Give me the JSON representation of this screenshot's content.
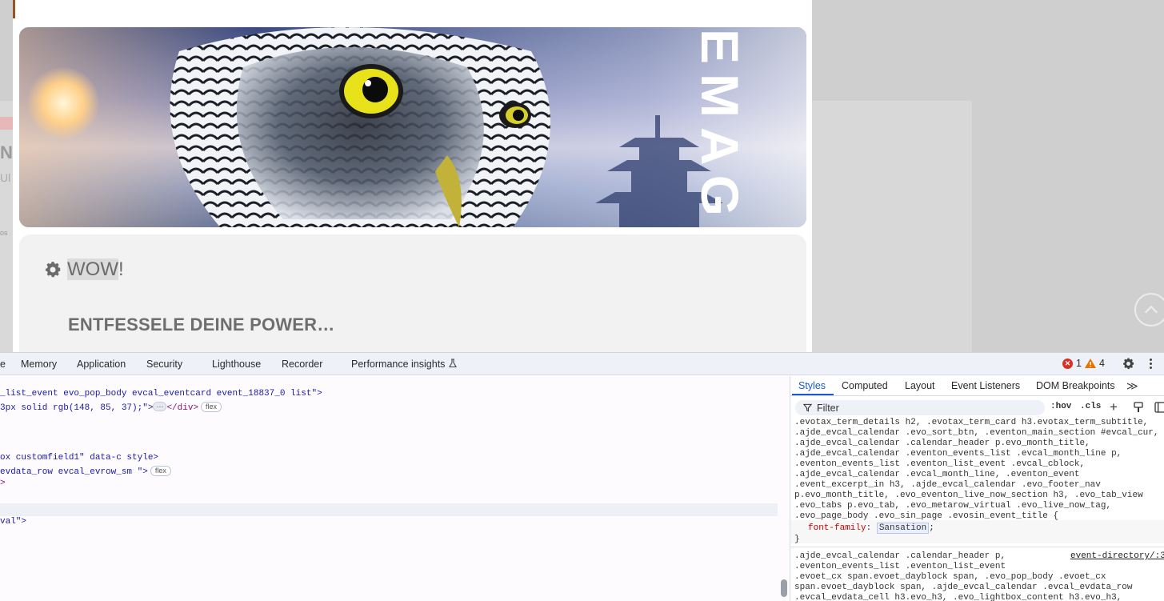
{
  "page": {
    "popup": {
      "banner_text": "EMAG",
      "heading_prefix": "WOW",
      "heading_suffix": "!",
      "subtitle": "ENTFESSELE DEINE POWER…",
      "accent_color": "#945525"
    }
  },
  "devtools": {
    "tabs": [
      {
        "label": "e"
      },
      {
        "label": "Memory"
      },
      {
        "label": "Application"
      },
      {
        "label": "Security"
      },
      {
        "label": "Lighthouse"
      },
      {
        "label": "Recorder"
      },
      {
        "label": "Performance insights"
      }
    ],
    "status": {
      "errors": "1",
      "warnings": "4"
    },
    "elements": {
      "lines": [
        {
          "pre": "_list_event evo_pop_body evcal_eventcard event_18837_0 list\">",
          "badge": ""
        },
        {
          "pre": "3px solid rgb(148, 85, 37);\">",
          "ellipsis": "⋯",
          "post": "</div>",
          "badge": "flex"
        },
        {
          "pre": "ox customfield1\" data-c style>",
          "badge": ""
        },
        {
          "pre": "evdata_row evcal_evrow_sm \">",
          "badge": "flex"
        },
        {
          "pre": ">",
          "badge": ""
        },
        {
          "pre": "val\">",
          "badge": ""
        }
      ]
    },
    "styles": {
      "tabs": [
        {
          "label": "Styles"
        },
        {
          "label": "Computed"
        },
        {
          "label": "Layout"
        },
        {
          "label": "Event Listeners"
        },
        {
          "label": "DOM Breakpoints"
        }
      ],
      "more_label": "≫",
      "filter_placeholder": "Filter",
      "hov_label": ":hov",
      "cls_label": ".cls",
      "add_label": "+",
      "rule1_selectors": [
        ".evotax_term_details h2, .evotax_term_card h3.evotax_term_subtitle,",
        ".ajde_evcal_calendar .evo_sort_btn, .eventon_main_section #evcal_cur,",
        ".ajde_evcal_calendar .calendar_header p.evo_month_title,",
        ".ajde_evcal_calendar .eventon_events_list .evcal_month_line p,",
        ".eventon_events_list .eventon_list_event .evcal_cblock,",
        ".ajde_evcal_calendar .evcal_month_line, .eventon_event",
        ".event_excerpt_in h3, .ajde_evcal_calendar .evo_footer_nav",
        "p.evo_month_title, .evo_eventon_live_now_section h3, .evo_tab_view",
        ".evo_tabs p.evo_tab, .evo_metarow_virtual .evo_live_now_tag,",
        ".evo_page_body .evo_sin_page .evosin_event_title {"
      ],
      "rule1_prop": "font-family",
      "rule1_value": "Sansation",
      "rule1_close": "}",
      "rule2_selectors": [
        ".ajde_evcal_calendar .calendar_header p,",
        ".eventon_events_list .eventon_list_event",
        ".evoet_cx span.evoet_dayblock span, .evo_pop_body .evoet_cx",
        "span.evoet_dayblock span, .ajde_evcal_calendar .evcal_evdata_row",
        ".evcal_evdata_cell h3.evo_h3, .evo_lightbox_content h3.evo_h3,"
      ],
      "rule2_source": "event-directory/:3"
    }
  }
}
